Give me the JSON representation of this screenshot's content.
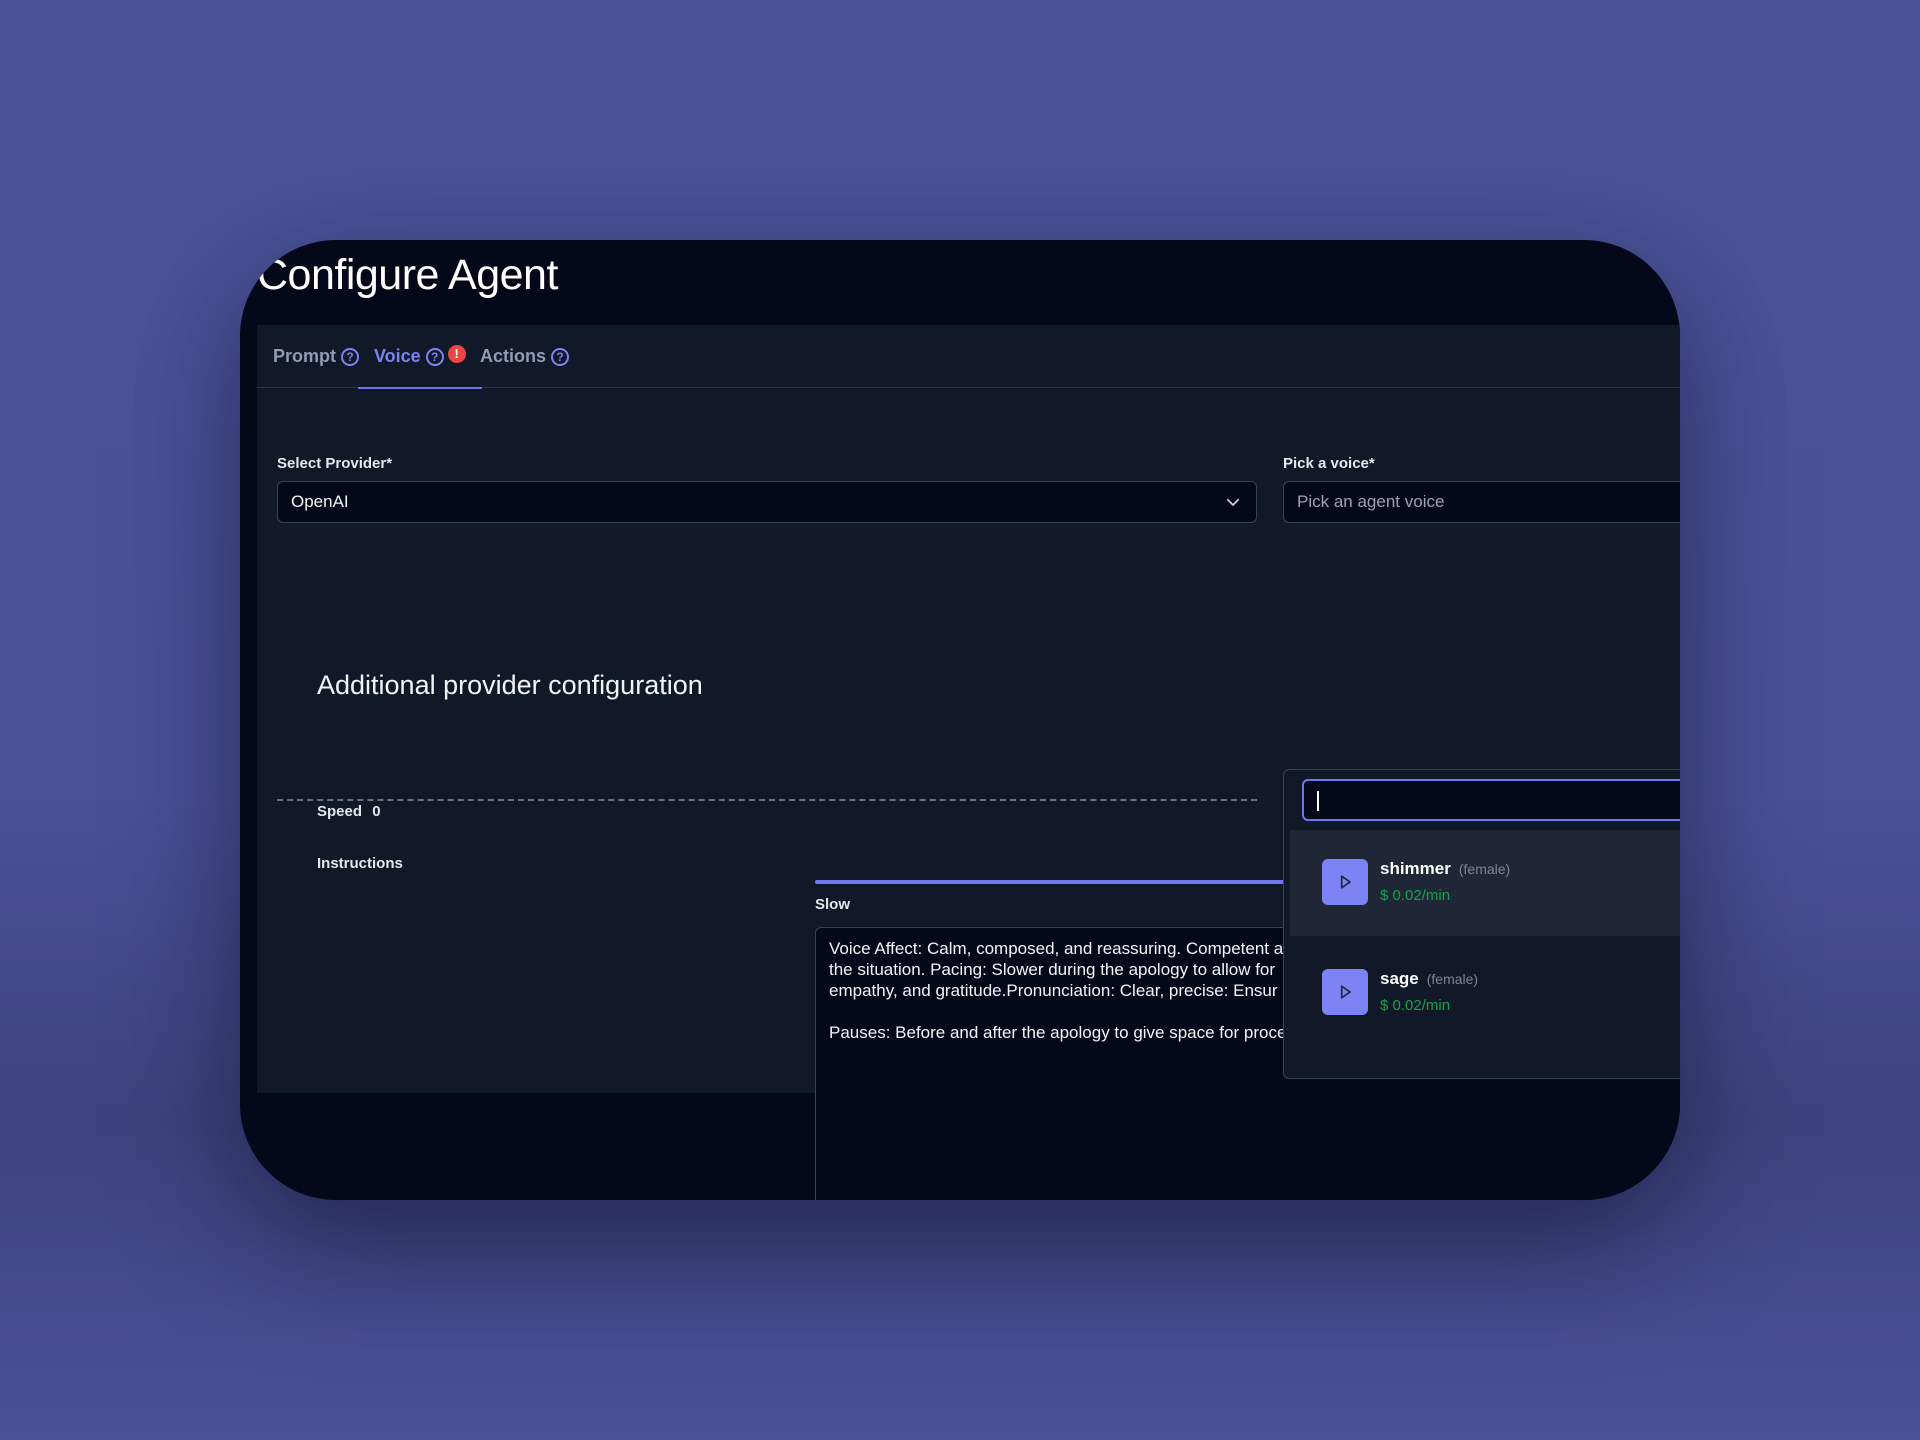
{
  "page": {
    "title": "Configure Agent"
  },
  "tabs": [
    {
      "label": "Prompt",
      "active": false,
      "help_icon": "help-circle-icon"
    },
    {
      "label": "Voice",
      "active": true,
      "help_icon": "help-circle-icon",
      "alert": "!"
    },
    {
      "label": "Actions",
      "active": false,
      "help_icon": "help-circle-icon"
    }
  ],
  "provider": {
    "label": "Select Provider*",
    "value": "OpenAI",
    "icon": "chevron-down-icon"
  },
  "voice_picker": {
    "label": "Pick a voice*",
    "placeholder": "Pick an agent voice",
    "search_value": "",
    "options": [
      {
        "name": "shimmer",
        "gender": "(female)",
        "price": "$ 0.02/min",
        "icon": "play-icon",
        "highlighted": true
      },
      {
        "name": "sage",
        "gender": "(female)",
        "price": "$ 0.02/min",
        "icon": "play-icon",
        "highlighted": false
      }
    ]
  },
  "additional_config": {
    "title": "Additional provider configuration",
    "speed_label": "Speed",
    "speed_value": "0",
    "slider_left_label": "Slow",
    "instructions_label": "Instructions",
    "instructions_text": "Voice Affect: Calm, composed, and reassuring. Competent a\nthe situation. Pacing: Slower during the apology to allow for\nempathy, and gratitude.Pronunciation: Clear, precise: Ensur\n\nPauses: Before and after the apology to give space for proce"
  },
  "colors": {
    "accent": "#7c83f5",
    "background": "#4b5398",
    "panel": "#111827",
    "input_bg": "#050818",
    "price": "#16a34a",
    "alert": "#ef4444"
  }
}
